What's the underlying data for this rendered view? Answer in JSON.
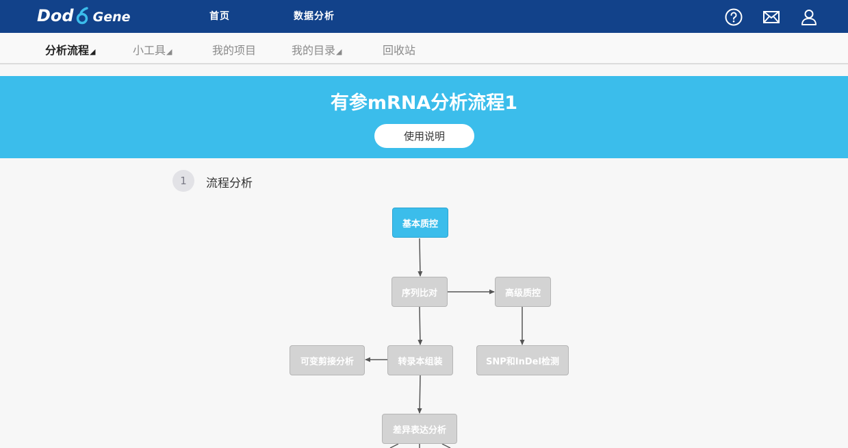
{
  "header": {
    "logo_main": "Dod",
    "logo_sub": "Gene",
    "nav": [
      "首页",
      "数据分析"
    ],
    "icons": [
      "help-icon",
      "mail-icon",
      "user-icon"
    ],
    "bg_color": "#12428a"
  },
  "subnav": {
    "items": [
      {
        "label": "分析流程",
        "dropdown": true,
        "active": true
      },
      {
        "label": "小工具",
        "dropdown": true,
        "active": false
      },
      {
        "label": "我的项目",
        "dropdown": false,
        "active": false
      },
      {
        "label": "我的目录",
        "dropdown": true,
        "active": false
      },
      {
        "label": "回收站",
        "dropdown": false,
        "active": false
      }
    ],
    "caret": "◢"
  },
  "banner": {
    "title": "有参mRNA分析流程1",
    "button_label": "使用说明",
    "bg_color": "#3bbdeb"
  },
  "step": {
    "number": "1",
    "label": "流程分析"
  },
  "flow": {
    "nodes": [
      {
        "id": "qc",
        "label": "基本质控",
        "active": true
      },
      {
        "id": "align",
        "label": "序列比对",
        "active": false
      },
      {
        "id": "adv_qc",
        "label": "高级质控",
        "active": false
      },
      {
        "id": "alt_splice",
        "label": "可变剪接分析",
        "active": false
      },
      {
        "id": "assembly",
        "label": "转录本组装",
        "active": false
      },
      {
        "id": "snp",
        "label": "SNP和InDel检测",
        "active": false
      },
      {
        "id": "diff",
        "label": "差异表达分析",
        "active": false
      }
    ],
    "edges": [
      [
        "qc",
        "align"
      ],
      [
        "align",
        "adv_qc"
      ],
      [
        "align",
        "assembly"
      ],
      [
        "adv_qc",
        "snp"
      ],
      [
        "assembly",
        "alt_splice"
      ],
      [
        "assembly",
        "diff"
      ]
    ]
  }
}
